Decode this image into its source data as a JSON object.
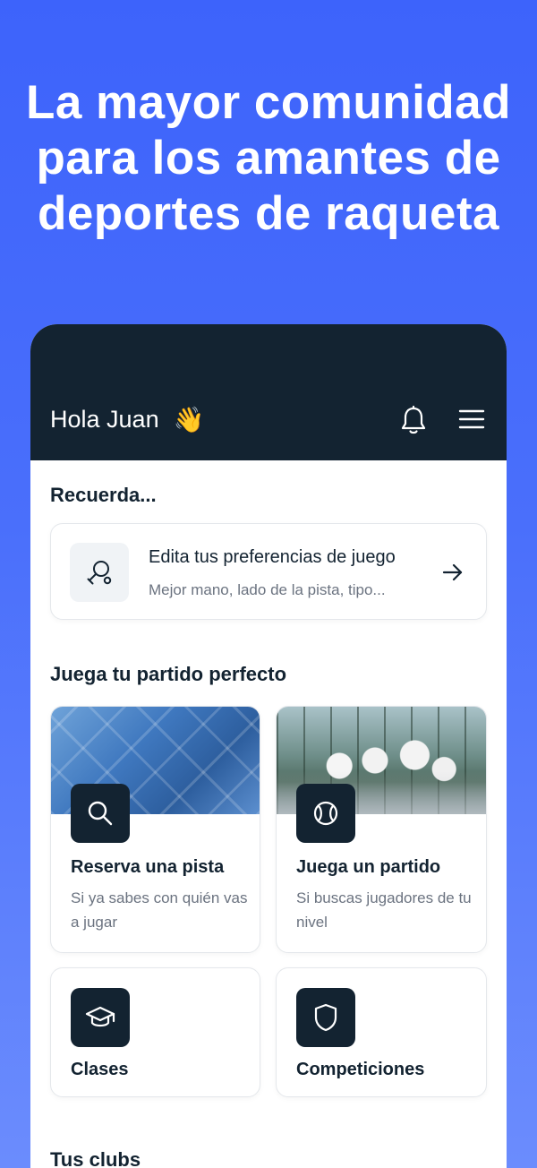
{
  "headline": {
    "line1": "La mayor comunidad",
    "line2": "para los amantes de",
    "line3": "deportes de raqueta"
  },
  "header": {
    "greeting": "Hola Juan",
    "wave_emoji": "👋",
    "bell_icon": "bell-icon",
    "menu_icon": "hamburger-menu-icon"
  },
  "reminder_section": {
    "title": "Recuerda...",
    "card": {
      "icon": "racket-icon",
      "title": "Edita tus preferencias de juego",
      "subtitle": "Mejor mano, lado de la pista, tipo...",
      "arrow_icon": "arrow-right-icon"
    }
  },
  "play_section": {
    "title": "Juega tu partido perfecto",
    "cards": [
      {
        "icon": "search-icon",
        "title": "Reserva una pista",
        "subtitle": "Si ya sabes con quién vas a jugar"
      },
      {
        "icon": "ball-icon",
        "title": "Juega un partido",
        "subtitle": "Si buscas jugadores de tu nivel"
      },
      {
        "icon": "graduation-cap-icon",
        "title": "Clases"
      },
      {
        "icon": "shield-icon",
        "title": "Competiciones"
      }
    ]
  },
  "clubs_section": {
    "title": "Tus clubs"
  },
  "colors": {
    "background_top": "#3d63fb",
    "background_bottom": "#6b8cfd",
    "dark_navy": "#132331",
    "muted_text": "#6b7380",
    "card_border": "#e4e7eb"
  }
}
